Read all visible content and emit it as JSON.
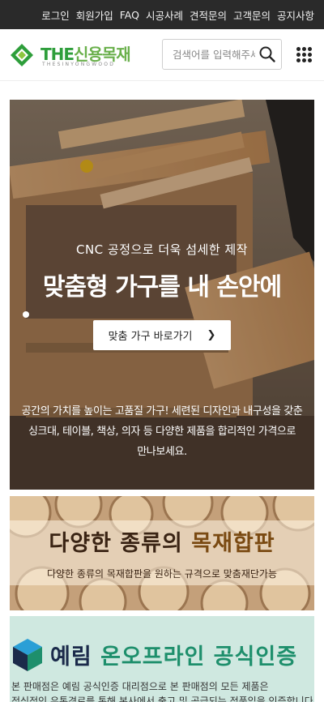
{
  "topbar": {
    "links": [
      "로그인",
      "회원가입",
      "FAQ",
      "시공사례",
      "견적문의",
      "고객문의",
      "공지사항"
    ]
  },
  "header": {
    "logo": {
      "the": "THE",
      "brand": "신용목재",
      "sub": "THESINYONGWOOD"
    },
    "search": {
      "placeholder": "검색어를 입력해주세요"
    },
    "icons": [
      "search-icon",
      "grid-menu-icon"
    ]
  },
  "hero": {
    "subtitle": "CNC 공정으로 더욱 섬세한 제작",
    "title": "맞춤형 가구를 내 손안에",
    "button_label": "맞춤 가구 바로가기",
    "button_icon": "chevron-right-icon",
    "description_lines": [
      "공간의 가치를 높이는 고품질 가구! 세련된 디자인과 내구성을 갖춘",
      "싱크대, 테이블, 책상, 의자 등 다양한 제품을 합리적인 가격으로",
      "만나보세요."
    ]
  },
  "banner_logs": {
    "title_prefix": "다양한 종류의 ",
    "title_highlight": "목재합판",
    "subtitle": "다양한 종류의 목재합판을 원하는 규격으로 맞춤재단가능"
  },
  "banner_yerim": {
    "name": "예림",
    "title_rest": " 온오프라인 공식인증",
    "desc_lines": [
      "본 판매점은 예림 공식인증 대리점으로 본 판매점의 모든 제품은",
      "정식적인 유통경로를 통해 본사에서 출고 및 공급되는 정품임을 인증합니다."
    ]
  },
  "colors": {
    "topbar_bg": "#2a2a2a",
    "brand_green": "#2e9e3b",
    "yerim_green": "#1e8f6c",
    "yerim_navy": "#1b2a4a"
  }
}
